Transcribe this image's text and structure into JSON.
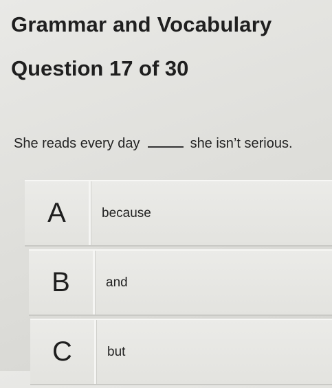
{
  "header": {
    "title": "Grammar and Vocabulary",
    "progress": "Question 17 of 30"
  },
  "question": {
    "before_blank": "She reads every day",
    "after_blank": "she isn’t serious."
  },
  "options": [
    {
      "letter": "A",
      "text": "because"
    },
    {
      "letter": "B",
      "text": "and"
    },
    {
      "letter": "C",
      "text": "but"
    }
  ]
}
